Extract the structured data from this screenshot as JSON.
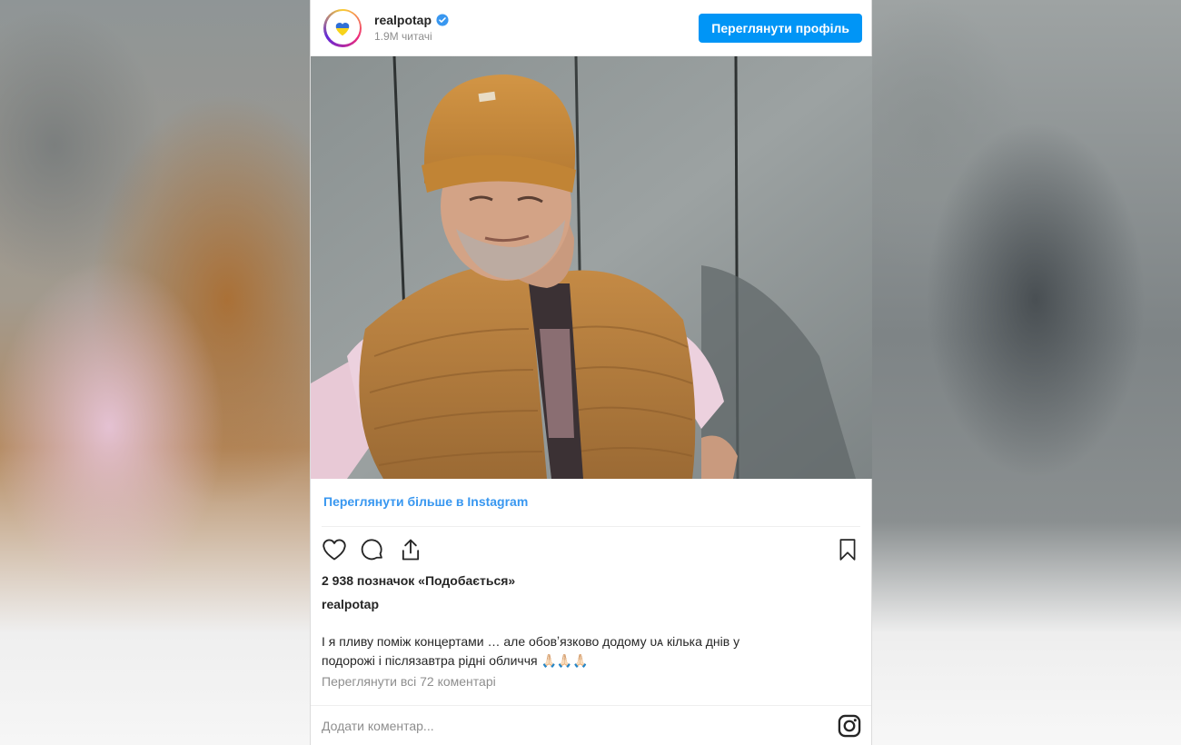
{
  "header": {
    "username": "realpotap",
    "followers": "1.9M читачі",
    "view_profile_label": "Переглянути профіль"
  },
  "post": {
    "view_more_label": "Переглянути більше в Instagram",
    "likes_text": "2 938 позначок «Подобається»",
    "caption_username": "realpotap",
    "caption_line1": "І я пливу поміж концертами … але обовʼязково додому ᴜᴀ кілька днів у",
    "caption_line2": "подорожі і післязавтра рідні обличчя 🙏🏻🙏🏻🙏🏻",
    "comments_link": "Переглянути всі 72 коментарі",
    "add_comment_placeholder": "Додати коментар..."
  },
  "icons": {
    "avatar": "ukraine-heart-icon",
    "verified": "verified-badge-icon",
    "like": "heart-icon",
    "comment": "comment-bubble-icon",
    "share": "share-icon",
    "save": "bookmark-icon",
    "brand": "instagram-icon"
  },
  "colors": {
    "accent": "#0095f6",
    "link": "#3897f0",
    "muted": "#8e8e8e",
    "text": "#262626"
  }
}
